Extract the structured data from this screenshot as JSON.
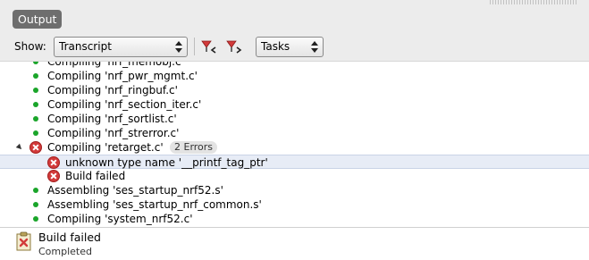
{
  "panel": {
    "title": "Output"
  },
  "toolbar": {
    "show_label": "Show:",
    "show_value": "Transcript",
    "tasks_value": "Tasks"
  },
  "rows": [
    {
      "text": "Compiling 'nrf_memobj.c'",
      "kind": "ok"
    },
    {
      "text": "Compiling 'nrf_pwr_mgmt.c'",
      "kind": "ok"
    },
    {
      "text": "Compiling 'nrf_ringbuf.c'",
      "kind": "ok"
    },
    {
      "text": "Compiling 'nrf_section_iter.c'",
      "kind": "ok"
    },
    {
      "text": "Compiling 'nrf_sortlist.c'",
      "kind": "ok"
    },
    {
      "text": "Compiling 'nrf_strerror.c'",
      "kind": "ok"
    },
    {
      "text": "Compiling 'retarget.c'",
      "kind": "error-parent",
      "badge": "2 Errors"
    },
    {
      "text": "unknown type name '__printf_tag_ptr'",
      "kind": "error-child",
      "selected": true
    },
    {
      "text": "Build failed",
      "kind": "error-child"
    },
    {
      "text": "Assembling 'ses_startup_nrf52.s'",
      "kind": "ok"
    },
    {
      "text": "Assembling 'ses_startup_nrf_common.s'",
      "kind": "ok"
    },
    {
      "text": "Compiling 'system_nrf52.c'",
      "kind": "ok"
    }
  ],
  "status": {
    "title": "Build failed",
    "subtitle": "Completed"
  },
  "colors": {
    "ok_dot": "#1aa52a",
    "error": "#d23a3a",
    "selection": "#e7ecf6"
  }
}
